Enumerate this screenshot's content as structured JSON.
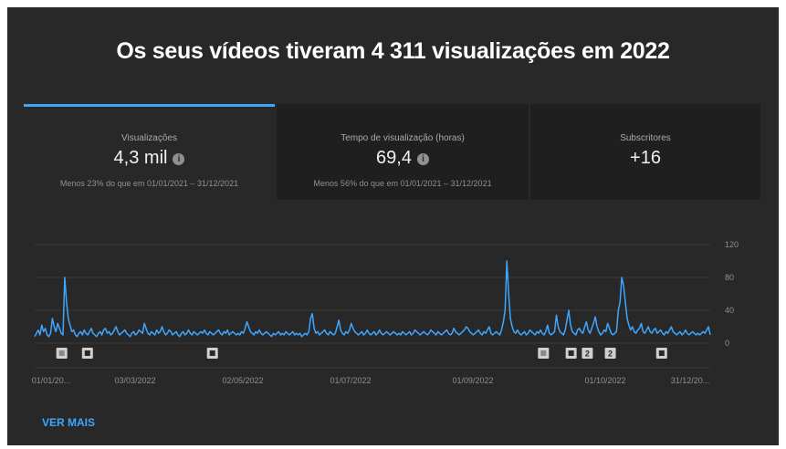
{
  "headline": "Os seus vídeos tiveram 4 311 visualizações em 2022",
  "tabs": [
    {
      "label": "Visualizações",
      "value": "4,3 mil",
      "info_icon": "info-icon",
      "comparison": "Menos 23% do que em 01/01/2021 – 31/12/2021",
      "active": true
    },
    {
      "label": "Tempo de visualização (horas)",
      "value": "69,4",
      "info_icon": "info-icon",
      "comparison": "Menos 56% do que em 01/01/2021 – 31/12/2021",
      "active": false
    },
    {
      "label": "Subscritores",
      "value": "+16",
      "comparison": "",
      "active": false
    }
  ],
  "chart_data": {
    "type": "line",
    "y_ticks": [
      "120",
      "80",
      "40",
      "0"
    ],
    "ylim": [
      0,
      120
    ],
    "x_labels": [
      "01/01/20...",
      "03/03/2022",
      "02/05/2022",
      "01/07/2022",
      "01/09/2022",
      "01/10/2022",
      "31/12/20..."
    ],
    "grid": true,
    "series_color": "#3ea6ff",
    "series": [
      {
        "values": [
          8,
          12,
          16,
          10,
          22,
          14,
          18,
          10,
          8,
          12,
          30,
          20,
          14,
          24,
          18,
          12,
          10,
          80,
          50,
          30,
          22,
          14,
          16,
          10,
          8,
          12,
          14,
          10,
          16,
          12,
          10,
          14,
          18,
          12,
          10,
          8,
          12,
          14,
          10,
          16,
          18,
          12,
          14,
          10,
          12,
          16,
          20,
          14,
          10,
          12,
          14,
          16,
          12,
          10,
          8,
          12,
          14,
          10,
          12,
          16,
          14,
          12,
          24,
          18,
          12,
          10,
          14,
          12,
          10,
          16,
          12,
          14,
          20,
          14,
          10,
          12,
          16,
          14,
          10,
          12,
          14,
          10,
          8,
          12,
          14,
          10,
          12,
          16,
          12,
          10,
          14,
          12,
          10,
          12,
          14,
          12,
          16,
          12,
          10,
          14,
          12,
          10,
          12,
          14,
          16,
          12,
          10,
          14,
          12,
          16,
          10,
          12,
          14,
          12,
          10,
          12,
          10,
          14,
          12,
          18,
          26,
          20,
          14,
          12,
          10,
          14,
          12,
          16,
          12,
          10,
          12,
          14,
          12,
          10,
          8,
          12,
          10,
          12,
          14,
          10,
          12,
          10,
          14,
          12,
          10,
          12,
          14,
          10,
          12,
          10,
          12,
          8,
          10,
          12,
          10,
          14,
          30,
          36,
          18,
          12,
          14,
          10,
          12,
          14,
          16,
          12,
          10,
          14,
          12,
          10,
          12,
          20,
          28,
          16,
          12,
          10,
          14,
          12,
          16,
          24,
          18,
          14,
          12,
          10,
          12,
          14,
          10,
          12,
          16,
          12,
          10,
          12,
          14,
          10,
          12,
          16,
          12,
          10,
          12,
          14,
          12,
          10,
          12,
          14,
          12,
          10,
          12,
          10,
          14,
          12,
          10,
          12,
          14,
          10,
          12,
          16,
          14,
          12,
          10,
          12,
          14,
          12,
          10,
          12,
          16,
          14,
          12,
          10,
          14,
          12,
          10,
          12,
          14,
          16,
          12,
          10,
          12,
          18,
          14,
          12,
          10,
          12,
          14,
          16,
          20,
          18,
          14,
          12,
          10,
          12,
          14,
          16,
          12,
          10,
          14,
          12,
          16,
          20,
          12,
          10,
          12,
          14,
          12,
          10,
          16,
          26,
          40,
          100,
          60,
          30,
          20,
          14,
          12,
          16,
          12,
          10,
          12,
          14,
          10,
          12,
          16,
          14,
          12,
          10,
          14,
          12,
          16,
          12,
          10,
          14,
          22,
          12,
          10,
          12,
          14,
          34,
          20,
          14,
          12,
          10,
          16,
          28,
          40,
          22,
          14,
          12,
          10,
          16,
          18,
          14,
          12,
          20,
          26,
          16,
          12,
          18,
          24,
          32,
          20,
          14,
          10,
          12,
          16,
          14,
          24,
          18,
          12,
          10,
          12,
          14,
          40,
          50,
          80,
          70,
          50,
          30,
          22,
          16,
          20,
          14,
          12,
          16,
          18,
          24,
          14,
          12,
          16,
          20,
          14,
          12,
          16,
          18,
          12,
          14,
          16,
          12,
          10,
          14,
          12,
          16,
          20,
          14,
          12,
          10,
          12,
          14,
          10,
          12,
          16,
          12,
          10,
          12,
          14,
          12,
          10,
          12,
          10,
          12,
          14,
          12,
          16,
          20,
          10
        ]
      }
    ],
    "annotations": [
      {
        "at": 0.032,
        "type": "square"
      },
      {
        "at": 0.07,
        "type": "play"
      },
      {
        "at": 0.255,
        "type": "play"
      },
      {
        "at": 0.745,
        "type": "square"
      },
      {
        "at": 0.786,
        "type": "play"
      },
      {
        "at": 0.81,
        "type": "number",
        "text": "2"
      },
      {
        "at": 0.844,
        "type": "number",
        "text": "2"
      },
      {
        "at": 0.92,
        "type": "play"
      }
    ]
  },
  "footer": {
    "more_label": "VER MAIS"
  }
}
